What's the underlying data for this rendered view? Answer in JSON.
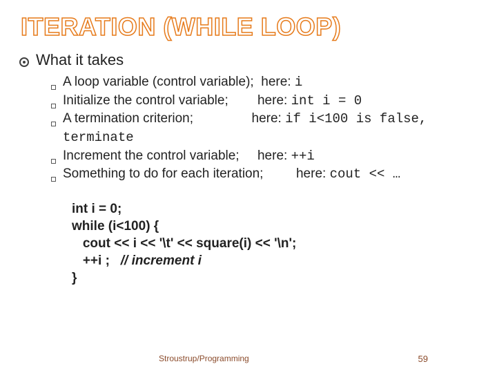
{
  "title": "ITERATION (WHILE LOOP)",
  "heading": "What it takes",
  "items": [
    {
      "text": "A loop variable (control variable);",
      "note": "i"
    },
    {
      "text": "Initialize the control variable;",
      "note": "int i = 0"
    },
    {
      "text": "A  termination criterion;",
      "note": "if i<100 is false, terminate"
    },
    {
      "text": "Increment the control variable;",
      "note": "++i"
    },
    {
      "text": "Something to do for each iteration;",
      "note": "cout << …"
    }
  ],
  "code": {
    "l1": "int i = 0;",
    "l2": "while (i<100) {",
    "l3": "   cout << i << '\\t' << square(i) << '\\n';",
    "l4a": "   ++i ;   ",
    "l4b": "// increment i",
    "l5": "}"
  },
  "footer": {
    "attribution": "Stroustrup/Programming",
    "page": "59"
  },
  "here_label": "here: "
}
